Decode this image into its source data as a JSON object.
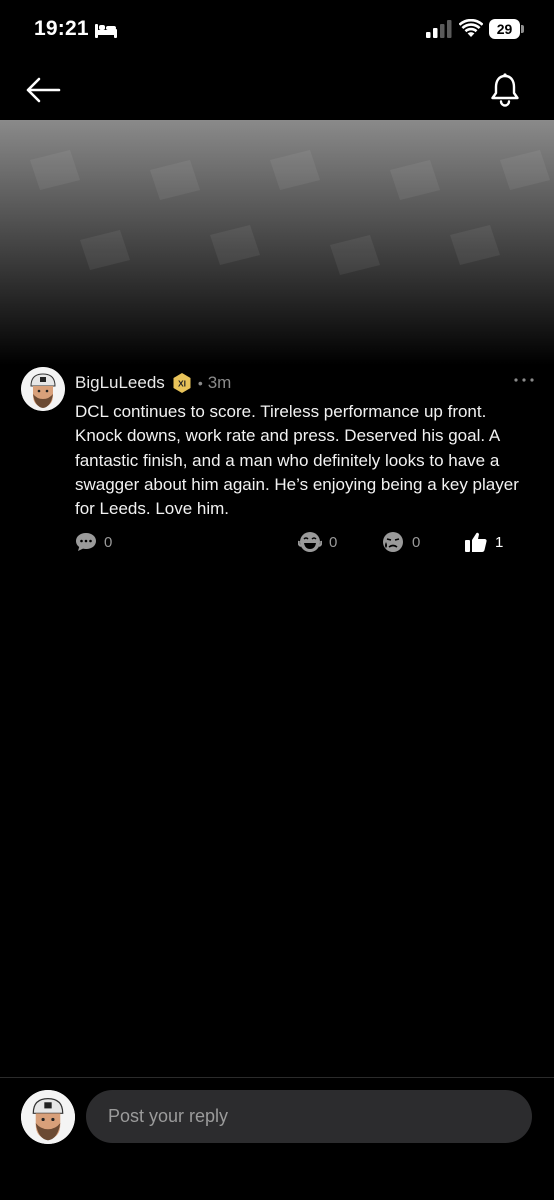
{
  "status_bar": {
    "time": "19:21",
    "battery": "29"
  },
  "post": {
    "author": "BigLuLeeds",
    "badge_text": "XI",
    "separator": "•",
    "time_ago": "3m",
    "body": "DCL continues to score. Tireless performance up front. Knock downs, work rate and press. Deserved his goal. A fantastic finish, and a man who definitely looks to have a swagger about him again. He’s enjoying being a key player for Leeds. Love him.",
    "more_label": "···",
    "comments_count": "0",
    "laugh_count": "0",
    "cry_count": "0",
    "like_count": "1"
  },
  "reply": {
    "placeholder": "Post your reply"
  },
  "colors": {
    "background": "#000000",
    "badge_gold": "#e8c35a",
    "input_bg": "#2c2c2e",
    "muted": "#8a8a8a"
  },
  "icons": [
    "bed-icon",
    "signal-icon",
    "wifi-icon",
    "battery-icon",
    "back-arrow-icon",
    "bell-icon",
    "verified-badge-icon",
    "more-dots-icon",
    "comment-icon",
    "laugh-emoji-icon",
    "cry-emoji-icon",
    "thumbs-up-icon"
  ]
}
